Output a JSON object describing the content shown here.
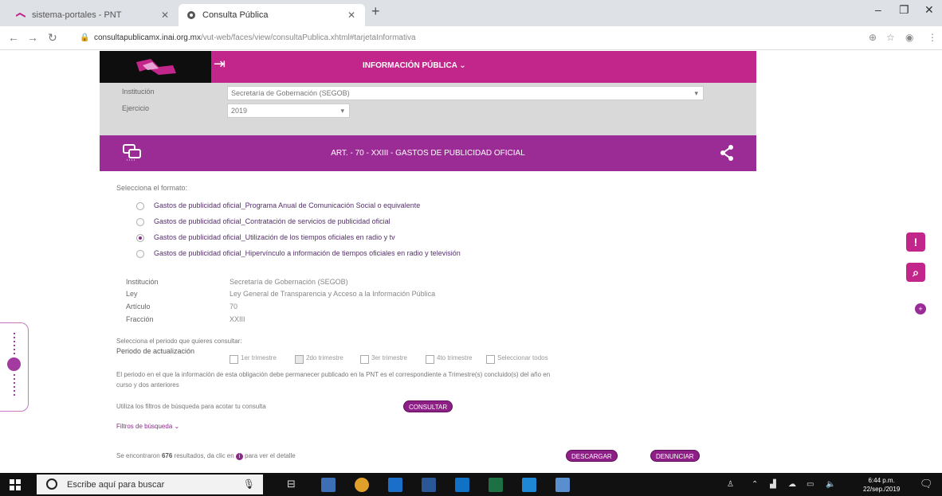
{
  "browser": {
    "tabs": [
      {
        "label": "sistema-portales - PNT",
        "active": false
      },
      {
        "label": "Consulta Pública",
        "active": true
      }
    ],
    "url_host": "consultapublicamx.inai.org.mx",
    "url_path": "/vut-web/faces/view/consultaPublica.xhtml#tarjetaInformativa"
  },
  "header": {
    "menu_label": "INFORMACIÓN PÚBLICA",
    "brand_color": "#c2268a"
  },
  "filters": {
    "institucion_label": "Institución",
    "institucion_value": "Secretaría de Gobernación (SEGOB)",
    "ejercicio_label": "Ejercicio",
    "ejercicio_value": "2019"
  },
  "article": {
    "title": "ART. - 70 - XXIII - GASTOS DE PUBLICIDAD OFICIAL",
    "band_color": "#9b2b95"
  },
  "formato": {
    "prompt": "Selecciona el formato:",
    "options": [
      {
        "label": "Gastos de publicidad oficial_Programa Anual de Comunicación Social o equivalente",
        "selected": false
      },
      {
        "label": "Gastos de publicidad oficial_Contratación de servicios de publicidad oficial",
        "selected": false
      },
      {
        "label": "Gastos de publicidad oficial_Utilización de los tiempos oficiales en radio y tv",
        "selected": true
      },
      {
        "label": "Gastos de publicidad oficial_Hipervínculo a información de tiempos oficiales en radio y televisión",
        "selected": false
      }
    ]
  },
  "details": [
    {
      "key": "Institución",
      "value": "Secretaría de Gobernación (SEGOB)"
    },
    {
      "key": "Ley",
      "value": "Ley General de Transparencia y Acceso a la Información Pública"
    },
    {
      "key": "Artículo",
      "value": "70"
    },
    {
      "key": "Fracción",
      "value": "XXIII"
    }
  ],
  "periodo": {
    "prompt": "Selecciona el periodo que quieres consultar:",
    "label": "Periodo de actualización",
    "options": [
      {
        "label": "1er trimestre",
        "checked": false
      },
      {
        "label": "2do trimestre",
        "checked": true
      },
      {
        "label": "3er trimestre",
        "checked": false
      },
      {
        "label": "4to trimestre",
        "checked": false
      },
      {
        "label": "Seleccionar todos",
        "checked": false
      }
    ],
    "note_line1": "El periodo en el que la información de esta obligación debe permanecer publicado en la PNT es el correspondiente a Trimestre(s) concluido(s) del año en",
    "note_line2": "curso y dos anteriores"
  },
  "search": {
    "hint": "Utiliza los filtros de búsqueda para acotar tu consulta",
    "consultar_label": "CONSULTAR",
    "filters_link": "Filtros de búsqueda"
  },
  "results": {
    "prefix": "Se encontraron",
    "count": "676",
    "suffix": "resultados, da clic en",
    "suffix2": "para ver el detalle",
    "download_label": "DESCARGAR",
    "denounce_label": "DENUNCIAR"
  },
  "taskbar": {
    "search_placeholder": "Escribe aquí para buscar",
    "time": "6:44 p.m.",
    "date": "22/sep./2019"
  }
}
